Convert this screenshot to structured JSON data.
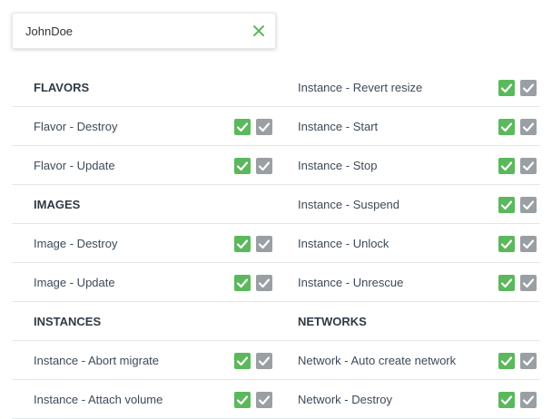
{
  "search": {
    "value": "JohnDoe",
    "clear_icon": "close-icon"
  },
  "colors": {
    "allowed": "#5cb85c",
    "inherited": "#9a9fa4",
    "clear": "#5cb85c"
  },
  "left_column": [
    {
      "type": "header",
      "label": "FLAVORS"
    },
    {
      "type": "permission",
      "label": "Flavor - Destroy"
    },
    {
      "type": "permission",
      "label": "Flavor - Update"
    },
    {
      "type": "header",
      "label": "IMAGES"
    },
    {
      "type": "permission",
      "label": "Image - Destroy"
    },
    {
      "type": "permission",
      "label": "Image - Update"
    },
    {
      "type": "header",
      "label": "INSTANCES"
    },
    {
      "type": "permission",
      "label": "Instance - Abort migrate"
    },
    {
      "type": "permission",
      "label": "Instance - Attach volume"
    }
  ],
  "right_column": [
    {
      "type": "permission",
      "label": "Instance - Revert resize"
    },
    {
      "type": "permission",
      "label": "Instance - Start"
    },
    {
      "type": "permission",
      "label": "Instance - Stop"
    },
    {
      "type": "permission",
      "label": "Instance - Suspend"
    },
    {
      "type": "permission",
      "label": "Instance - Unlock"
    },
    {
      "type": "permission",
      "label": "Instance - Unrescue"
    },
    {
      "type": "header",
      "label": "NETWORKS"
    },
    {
      "type": "permission",
      "label": "Network - Auto create network"
    },
    {
      "type": "permission",
      "label": "Network - Destroy"
    }
  ]
}
